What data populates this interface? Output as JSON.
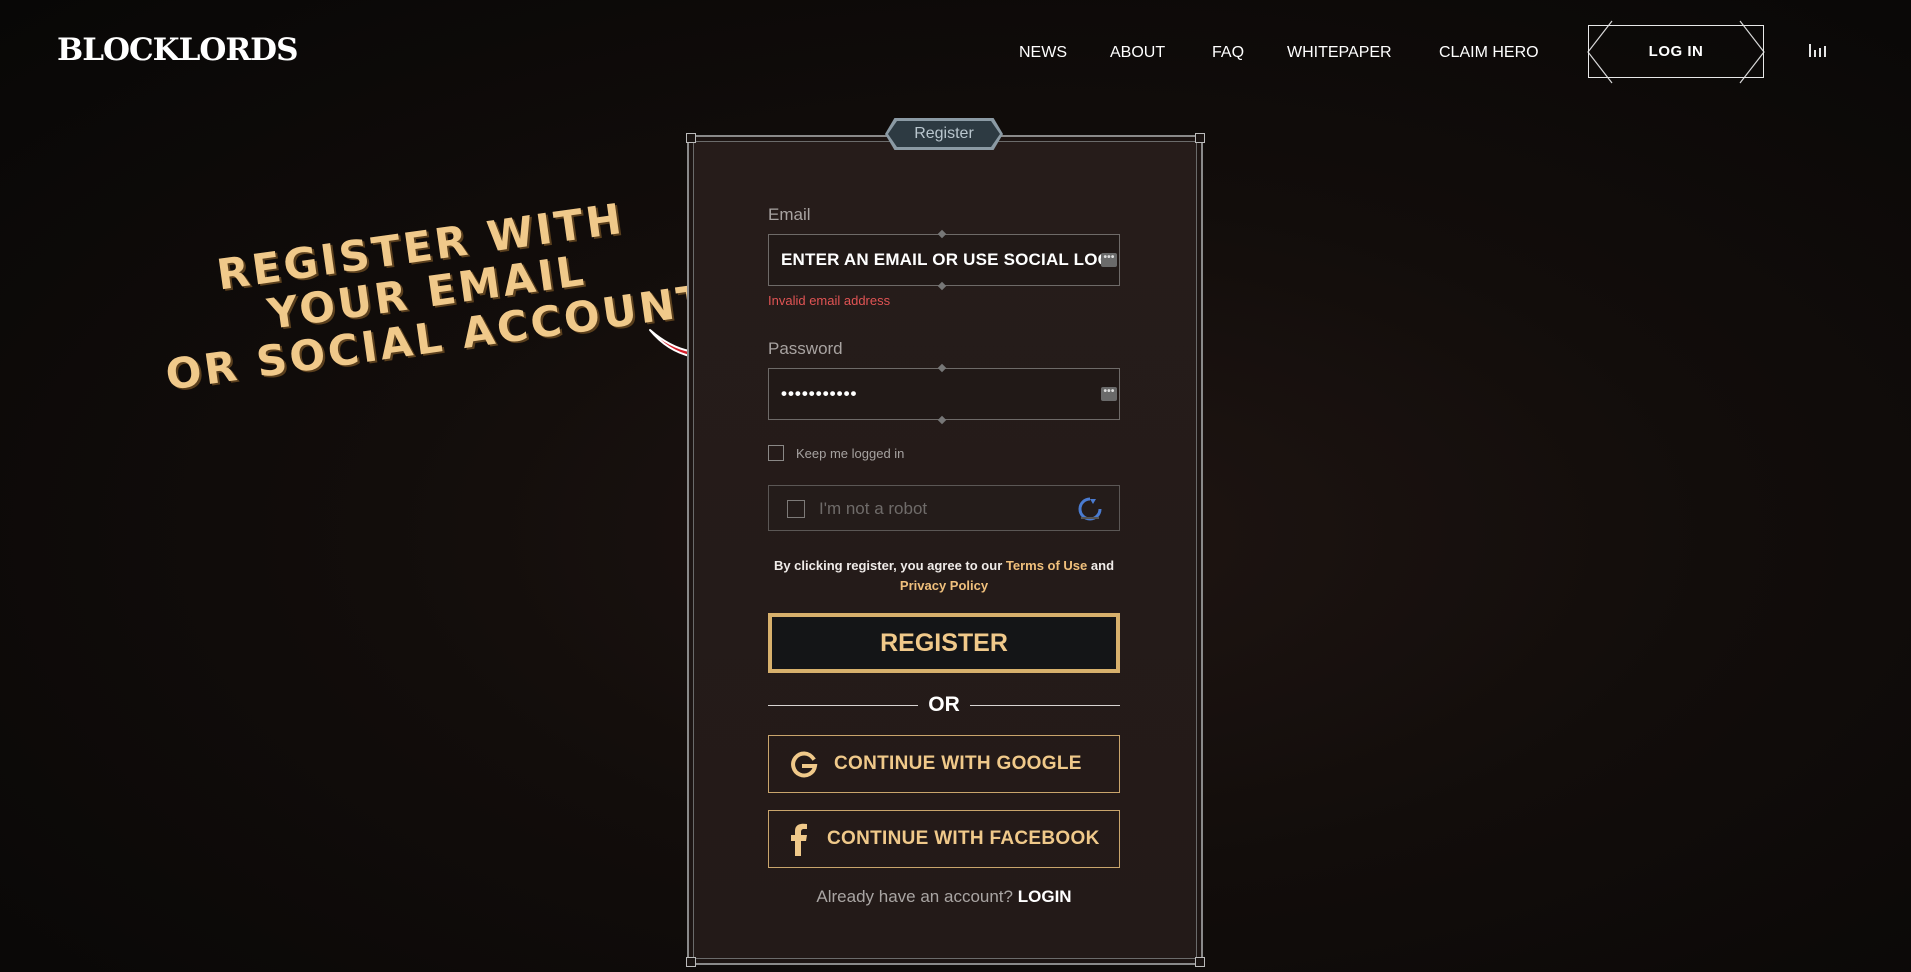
{
  "brand": {
    "logo": "BLOCKLORDS"
  },
  "nav": {
    "items": [
      "NEWS",
      "ABOUT",
      "FAQ",
      "WHITEPAPER",
      "CLAIM HERO"
    ],
    "login": "LOG IN"
  },
  "promo": {
    "lines": [
      "REGISTER WITH",
      "YOUR EMAIL",
      "OR SOCIAL ACCOUNT!"
    ]
  },
  "panel": {
    "tab": "Register",
    "email": {
      "label": "Email",
      "value": "ENTER AN EMAIL OR USE SOCIAL LOGIN",
      "error": "Invalid email address"
    },
    "password": {
      "label": "Password",
      "value": "•••••••••••"
    },
    "keep_logged": "Keep me logged in",
    "captcha": "I'm not a robot",
    "terms": {
      "prefix": "By clicking register, you agree to our",
      "terms_link": "Terms of Use",
      "and": "and",
      "privacy_link": "Privacy Policy"
    },
    "register": "REGISTER",
    "or": "OR",
    "google": "CONTINUE WITH GOOGLE",
    "facebook": "CONTINUE WITH FACEBOOK",
    "already": "Already have an account?",
    "login_link": "LOGIN"
  },
  "colors": {
    "accent_gold": "#f0c98a",
    "error_red": "#e05454",
    "arrow_red": "#d41e2a"
  }
}
